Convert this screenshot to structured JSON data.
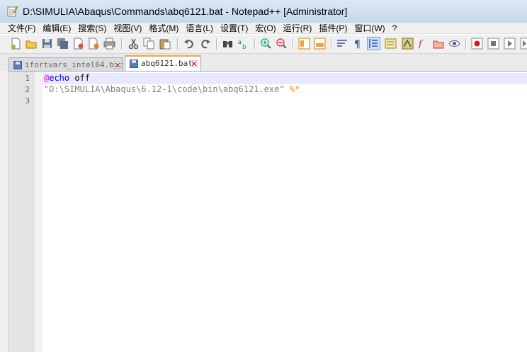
{
  "window": {
    "title": "D:\\SIMULIA\\Abaqus\\Commands\\abq6121.bat - Notepad++ [Administrator]"
  },
  "menu": [
    "文件(F)",
    "编辑(E)",
    "搜索(S)",
    "视图(V)",
    "格式(M)",
    "语言(L)",
    "设置(T)",
    "宏(O)",
    "运行(R)",
    "插件(P)",
    "窗口(W)",
    "?"
  ],
  "tabs": [
    {
      "label": "ifortvars_intel64.bat",
      "active": false
    },
    {
      "label": "abq6121.bat",
      "active": true
    }
  ],
  "editor": {
    "line_numbers": [
      "1",
      "2",
      "3"
    ],
    "line1": {
      "at": "@",
      "keyword": "echo",
      "text": " off"
    },
    "line2": {
      "string": "\"D:\\SIMULIA\\Abaqus\\6.12-1\\code\\bin\\abq6121.exe\"",
      "args": " %*"
    }
  },
  "colors": {
    "tab_active_accent": "#f4a83a",
    "current_line": "#e8e8ff",
    "keyword": "#0000ff",
    "at_sign": "#ff00ff",
    "string": "#808080",
    "operator": "#ff8000"
  }
}
